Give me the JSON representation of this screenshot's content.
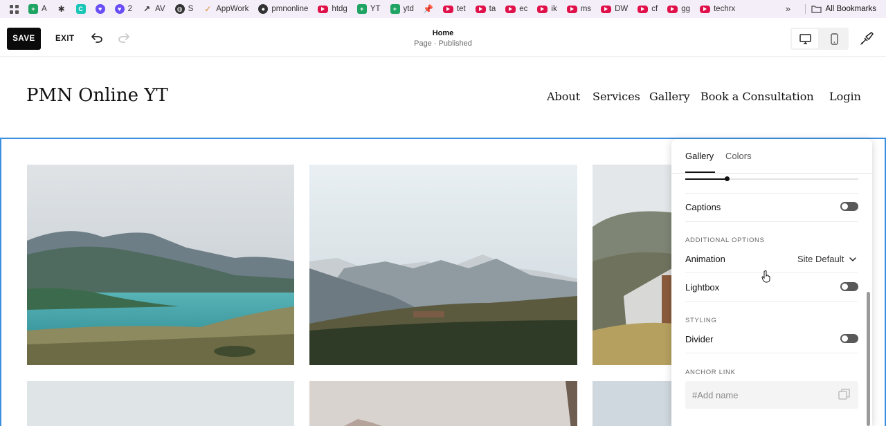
{
  "bookmarks": {
    "items": [
      {
        "label": "A",
        "icon": "sheets-icon"
      },
      {
        "label": "",
        "icon": "puzzle-icon"
      },
      {
        "label": "",
        "icon": "teal-app-icon"
      },
      {
        "label": "",
        "icon": "purple-heart-icon"
      },
      {
        "label": "2",
        "icon": "purple-heart-icon"
      },
      {
        "label": "AV",
        "icon": "trend-icon"
      },
      {
        "label": "S",
        "icon": "globe-icon"
      },
      {
        "label": "AppWork",
        "icon": "check-icon"
      },
      {
        "label": "pmnonline",
        "icon": "github-icon"
      },
      {
        "label": "htdg",
        "icon": "youtube-icon"
      },
      {
        "label": "YT",
        "icon": "sheets-icon"
      },
      {
        "label": "ytd",
        "icon": "sheets-icon"
      },
      {
        "label": "",
        "icon": "pin-icon"
      },
      {
        "label": "tet",
        "icon": "youtube-icon"
      },
      {
        "label": "ta",
        "icon": "youtube-icon"
      },
      {
        "label": "ec",
        "icon": "youtube-icon"
      },
      {
        "label": "ik",
        "icon": "youtube-icon"
      },
      {
        "label": "ms",
        "icon": "youtube-icon"
      },
      {
        "label": "DW",
        "icon": "youtube-icon"
      },
      {
        "label": "cf",
        "icon": "youtube-icon"
      },
      {
        "label": "gg",
        "icon": "youtube-icon"
      },
      {
        "label": "techrx",
        "icon": "youtube-icon"
      }
    ],
    "more": "»",
    "all_label": "All Bookmarks"
  },
  "toolbar": {
    "save_label": "SAVE",
    "exit_label": "EXIT",
    "page_title": "Home",
    "page_status": "Page · Published"
  },
  "site": {
    "title": "PMN Online YT",
    "nav": [
      "About",
      "Services",
      "Gallery",
      "Book a Consultation",
      "Login"
    ]
  },
  "panel": {
    "tabs": [
      "Gallery",
      "Colors"
    ],
    "active_tab": "Gallery",
    "slider_value_fraction": 0.24,
    "captions_label": "Captions",
    "captions_on": false,
    "additional_options_heading": "ADDITIONAL OPTIONS",
    "animation_label": "Animation",
    "animation_value": "Site Default",
    "lightbox_label": "Lightbox",
    "lightbox_on": false,
    "styling_heading": "STYLING",
    "divider_label": "Divider",
    "divider_on": false,
    "anchor_heading": "ANCHOR LINK",
    "anchor_placeholder": "#Add name"
  },
  "colors": {
    "selection_outline": "#3b8fe0",
    "save_bg": "#0b0b0b",
    "toggle_off": "#595959",
    "bookmark_bar": "#f4eef8"
  }
}
